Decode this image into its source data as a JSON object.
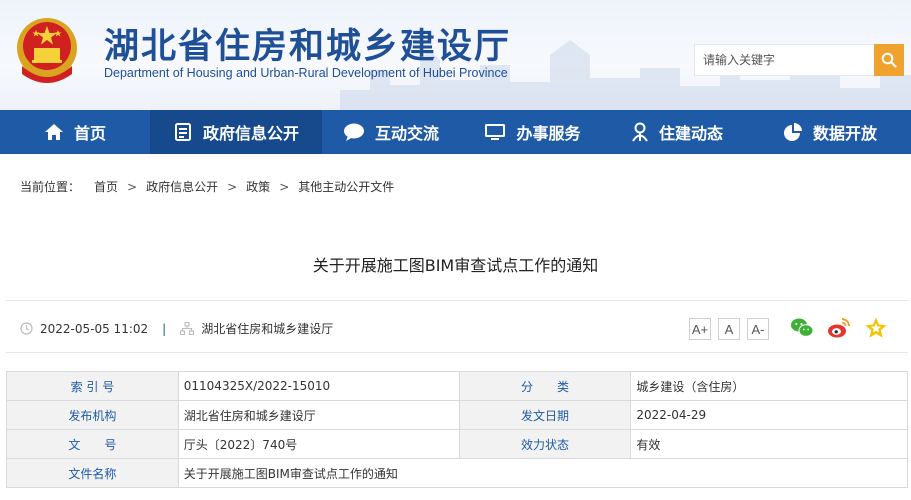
{
  "header": {
    "title": "湖北省住房和城乡建设厅",
    "subtitle": "Department of Housing and Urban-Rural Development of Hubei Province",
    "search_placeholder": "请输入关键字"
  },
  "nav": [
    {
      "label": "首页",
      "icon": "home-icon"
    },
    {
      "label": "政府信息公开",
      "icon": "document-list-icon",
      "active": true
    },
    {
      "label": "互动交流",
      "icon": "chat-bubble-icon"
    },
    {
      "label": "办事服务",
      "icon": "monitor-icon"
    },
    {
      "label": "住建动态",
      "icon": "person-pin-icon"
    },
    {
      "label": "数据开放",
      "icon": "pie-chart-icon"
    }
  ],
  "breadcrumb": {
    "lead": "当前位置：",
    "items": [
      "首页",
      "政府信息公开",
      "政策",
      "其他主动公开文件"
    ],
    "sep": ">"
  },
  "article": {
    "title": "关于开展施工图BIM审查试点工作的通知",
    "datetime": "2022-05-05 11:02",
    "divider": "|",
    "source": "湖北省住房和城乡建设厅",
    "font_buttons": [
      "A+",
      "A",
      "A-"
    ]
  },
  "info_table": {
    "rows": [
      {
        "k1": "索 引 号",
        "v1": "01104325X/2022-15010",
        "k2": "分　　类",
        "v2": "城乡建设（含住房）"
      },
      {
        "k1": "发布机构",
        "v1": "湖北省住房和城乡建设厅",
        "k2": "发文日期",
        "v2": "2022-04-29"
      },
      {
        "k1": "文　　号",
        "v1": "厅头〔2022〕740号",
        "k2": "效力状态",
        "v2": "有效"
      },
      {
        "k1": "文件名称",
        "v1": "关于开展施工图BIM审查试点工作的通知"
      }
    ]
  },
  "colors": {
    "nav_bg": "#1f5aa6",
    "nav_active": "#164a8d",
    "title_blue": "#1f4f97",
    "search_btn": "#f0a22e"
  }
}
